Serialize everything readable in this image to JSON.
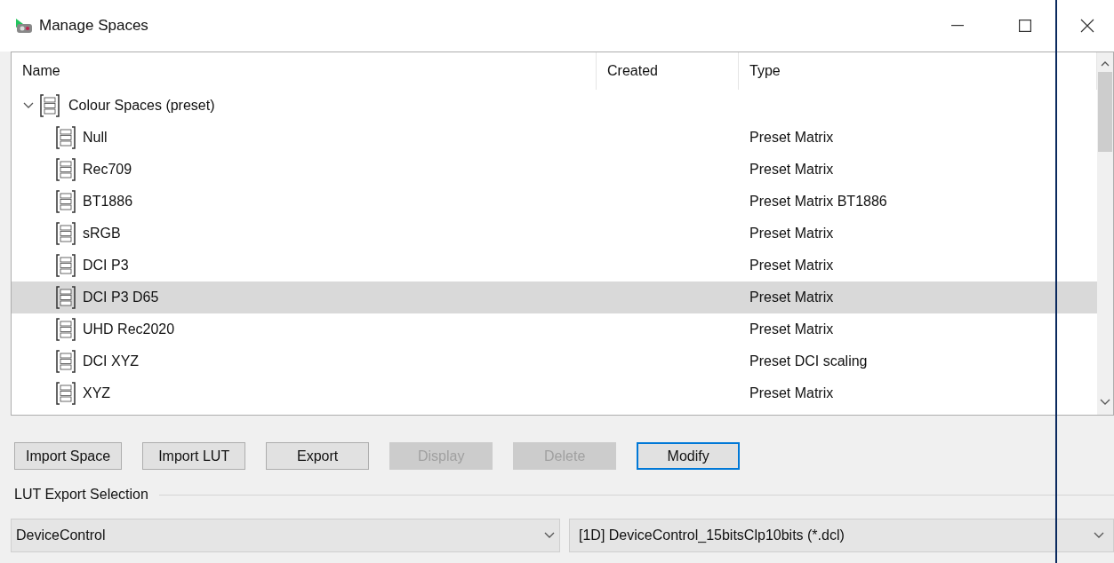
{
  "window": {
    "title": "Manage Spaces"
  },
  "table": {
    "columns": [
      {
        "label": "Name"
      },
      {
        "label": "Created"
      },
      {
        "label": "Type"
      }
    ],
    "rows": [
      {
        "name": "Colour Spaces (preset)",
        "expanded": true,
        "selected": false,
        "children": [
          {
            "name": "Null",
            "type": "Preset Matrix",
            "selected": false
          },
          {
            "name": "Rec709",
            "type": "Preset Matrix",
            "selected": false
          },
          {
            "name": "BT1886",
            "type": "Preset Matrix BT1886",
            "selected": false
          },
          {
            "name": "sRGB",
            "type": "Preset Matrix",
            "selected": false
          },
          {
            "name": "DCI P3",
            "type": "Preset Matrix",
            "selected": false
          },
          {
            "name": "DCI P3 D65",
            "type": "Preset Matrix",
            "selected": true
          },
          {
            "name": "UHD Rec2020",
            "type": "Preset Matrix",
            "selected": false
          },
          {
            "name": "DCI XYZ",
            "type": "Preset DCI scaling",
            "selected": false
          },
          {
            "name": "XYZ",
            "type": "Preset Matrix",
            "selected": false
          }
        ]
      }
    ]
  },
  "buttons": [
    {
      "label": "Import Space",
      "disabled": false,
      "focused": false
    },
    {
      "label": "Import LUT",
      "disabled": false,
      "focused": false
    },
    {
      "label": "Export",
      "disabled": false,
      "focused": false
    },
    {
      "label": "Display",
      "disabled": true,
      "focused": false
    },
    {
      "label": "Delete",
      "disabled": true,
      "focused": false
    },
    {
      "label": "Modify",
      "disabled": false,
      "focused": true
    }
  ],
  "lut_export": {
    "label": "LUT Export Selection",
    "device": "DeviceControl",
    "format": "[1D] DeviceControl_15bitsClp10bits (*.dcl)"
  }
}
